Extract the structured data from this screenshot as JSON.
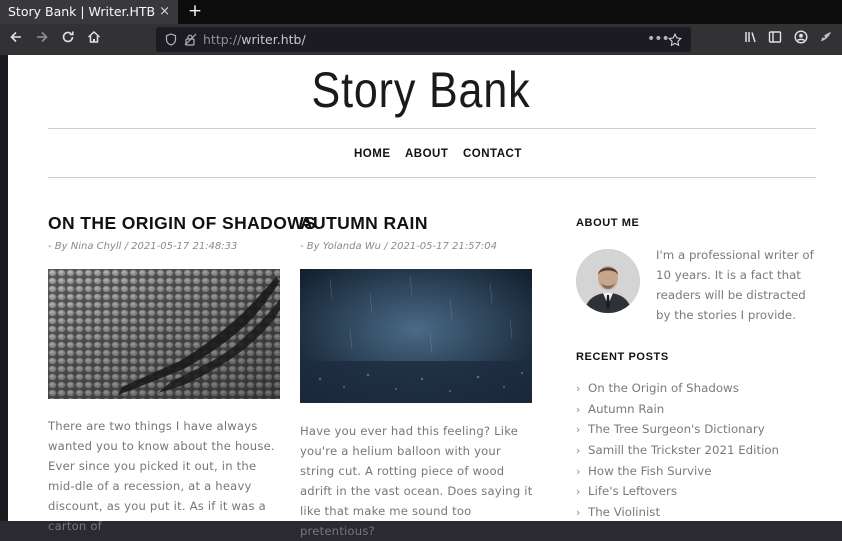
{
  "browser": {
    "tab_title": "Story Bank | Writer.HTB",
    "tab_close": "×",
    "new_tab": "+",
    "url_proto": "http://",
    "url_host": "writer.htb/"
  },
  "site": {
    "title": "Story Bank",
    "nav": [
      "HOME",
      "ABOUT",
      "CONTACT"
    ]
  },
  "posts": [
    {
      "title": "ON THE ORIGIN OF SHADOWS",
      "meta": "- By Nina Chyll / 2021-05-17 21:48:33",
      "excerpt": "There are two things I have always wanted you to know about the house. Ever since you picked it out, in the mid-dle of a recession, at a heavy discount, as you put it. As if it was a carton of"
    },
    {
      "title": "AUTUMN RAIN",
      "meta": "- By Yolanda Wu / 2021-05-17 21:57:04",
      "excerpt": "Have you ever had this feeling? Like you're a helium balloon with your string cut. A rotting piece of wood adrift in the vast ocean. Does saying it like that make me sound too pretentious?"
    }
  ],
  "sidebar": {
    "about_heading": "ABOUT ME",
    "about_text": "I'm a professional writer of 10 years. It is a fact that readers will be distracted by the stories I provide.",
    "recent_heading": "RECENT POSTS",
    "recent_posts": [
      "On the Origin of Shadows",
      "Autumn Rain",
      "The Tree Surgeon's Dictionary",
      "Samill the Trickster 2021 Edition",
      "How the Fish Survive",
      "Life's Leftovers",
      "The Violinist"
    ]
  }
}
